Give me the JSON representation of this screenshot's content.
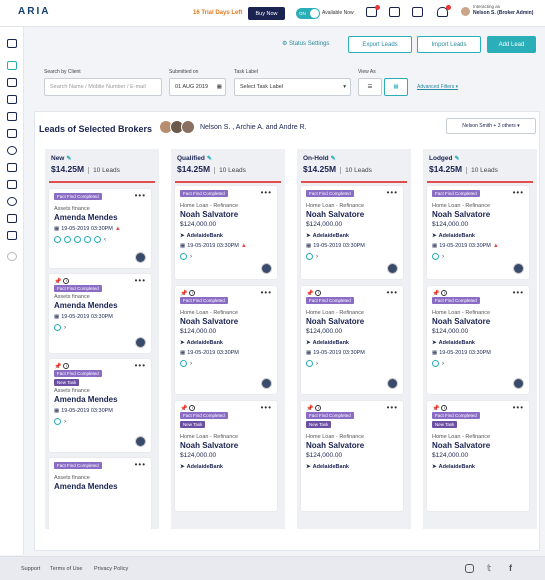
{
  "app": {
    "logo": "ARIA"
  },
  "header": {
    "trial": "16 Trial Days Left",
    "buy_now": "Buy Now",
    "toggle_on": "ON",
    "available": "Available Now",
    "interacting_as": "Interacting as",
    "user_name": "Nelson S. (Broker Admin)"
  },
  "toolbar": {
    "status_settings": "Status Settings",
    "export_leads": "Export Leads",
    "import_leads": "Import Leads",
    "add_lead": "Add Lead"
  },
  "filters": {
    "search_label": "Search by Client",
    "search_placeholder": "Search Name / Mobile Number / E-mail",
    "submitted_label": "Submitted on",
    "submitted_value": "01 AUG 2019",
    "task_label": "Task Label",
    "task_value": "Select Task Label",
    "view_label": "View As",
    "advanced": "Advanced Filters"
  },
  "panel": {
    "title": "Leads of Selected Brokers",
    "names": "Nelson S. , Archie A. and Andre R.",
    "broker_select": "Nelson Smith + 3 others"
  },
  "columns": [
    {
      "name": "New",
      "amount": "$14.25M",
      "count": "10 Leads"
    },
    {
      "name": "Qualified",
      "amount": "$14.25M",
      "count": "10 Leads"
    },
    {
      "name": "On-Hold",
      "amount": "$14.25M",
      "count": "10 Leads"
    },
    {
      "name": "Lodged",
      "amount": "$14.25M",
      "count": "10 Leads"
    }
  ],
  "card_text": {
    "fact_find": "Fact Find Completed",
    "new_task": "New Task",
    "assets": "Assets finance",
    "home_loan": "Home Loan - Refinance",
    "amanda": "Amenda Mendes",
    "noah": "Noah Salvatore",
    "amount": "$124,000.00",
    "bank": "AdelaideBank",
    "date": "19-05-2019 03:30PM"
  },
  "footer": {
    "support": "Support",
    "terms": "Terms of Use",
    "privacy": "Privacy Policy"
  }
}
